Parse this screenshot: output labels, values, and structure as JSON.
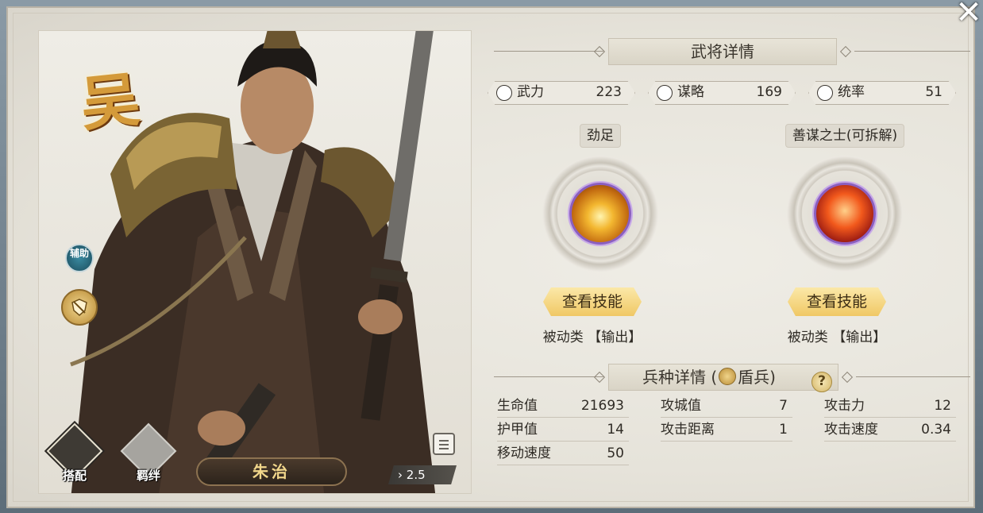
{
  "hero": {
    "faction": "吴",
    "role_badge": "辅助",
    "name": "朱治",
    "cost": "2.5",
    "buttons": {
      "equip": "搭配",
      "bond": "羁绊"
    }
  },
  "details": {
    "title": "武将详情",
    "stats": [
      {
        "name": "武力",
        "value": "223",
        "icon": "crossed-swords-icon"
      },
      {
        "name": "谋略",
        "value": "169",
        "icon": "strategy-icon"
      },
      {
        "name": "统率",
        "value": "51",
        "icon": "flag-icon"
      }
    ],
    "skills": [
      {
        "name": "劲足",
        "button": "查看技能",
        "type": "被动类",
        "tag": "【输出】",
        "icon": "golden-flame-icon"
      },
      {
        "name": "善谋之士(可拆解)",
        "button": "查看技能",
        "type": "被动类",
        "tag": "【输出】",
        "icon": "fire-warrior-icon"
      }
    ]
  },
  "troop": {
    "title_prefix": "兵种详情 (",
    "troop_type": "盾兵",
    "title_suffix": ")",
    "help": "?",
    "rows": [
      [
        {
          "k": "生命值",
          "v": "21693"
        },
        {
          "k": "攻城值",
          "v": "7"
        },
        {
          "k": "攻击力",
          "v": "12"
        }
      ],
      [
        {
          "k": "护甲值",
          "v": "14"
        },
        {
          "k": "攻击距离",
          "v": "1"
        },
        {
          "k": "攻击速度",
          "v": "0.34"
        }
      ],
      [
        {
          "k": "移动速度",
          "v": "50"
        }
      ]
    ]
  },
  "close": "✕"
}
